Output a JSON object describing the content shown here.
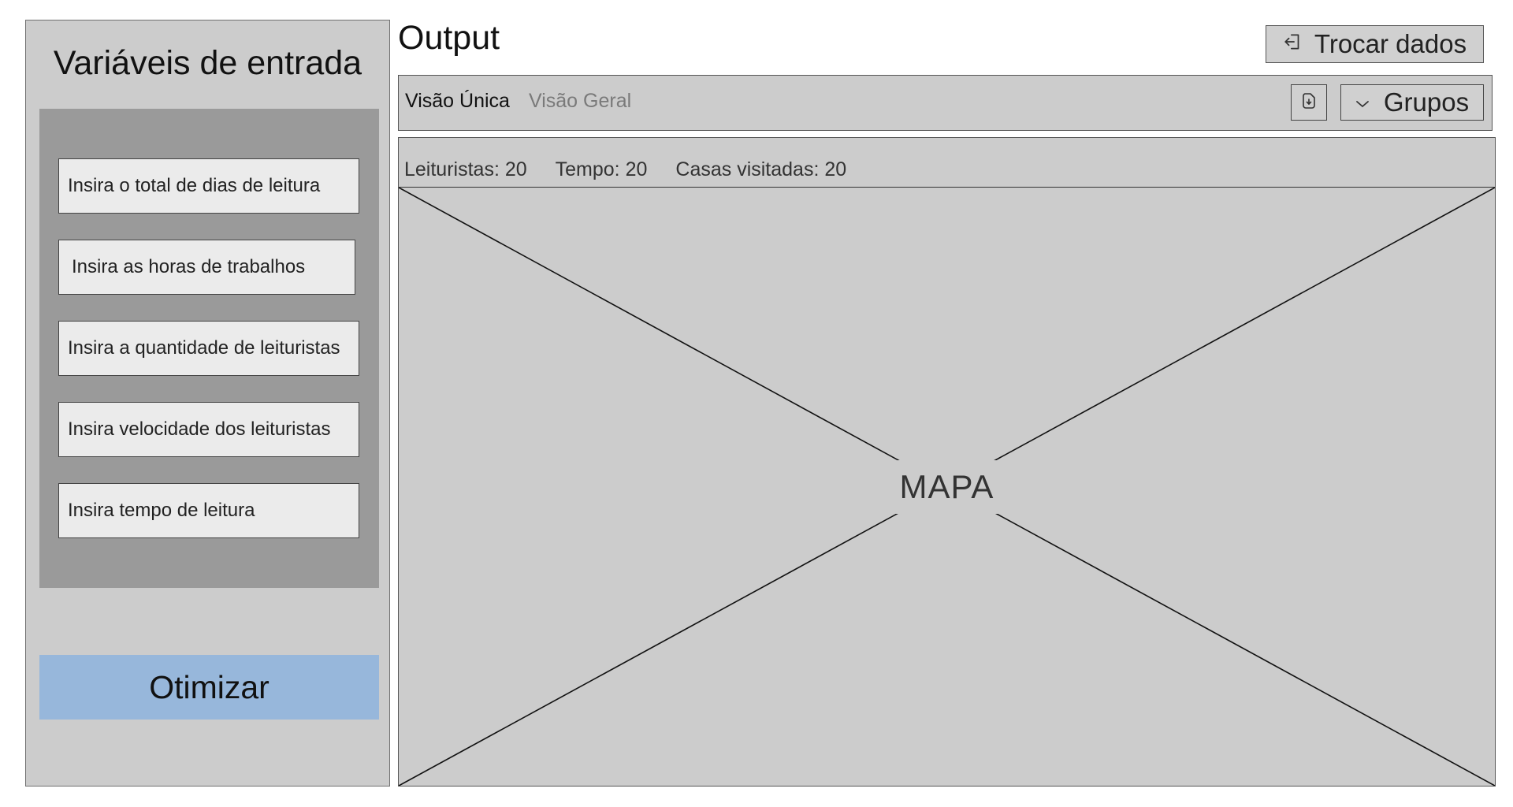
{
  "left_panel": {
    "title": "Variáveis de entrada",
    "fields": [
      {
        "placeholder": "Insira o total de dias de leitura"
      },
      {
        "placeholder": "Insira as horas de trabalhos"
      },
      {
        "placeholder": "Insira a quantidade de leituristas"
      },
      {
        "placeholder": "Insira velocidade dos leituristas"
      },
      {
        "placeholder": "Insira tempo de leitura"
      }
    ],
    "optimize_label": "Otimizar"
  },
  "output": {
    "title": "Output",
    "swap_label": "Trocar dados",
    "swap_icon": "sign-in-icon"
  },
  "tabs": [
    {
      "label": "Visão Única",
      "active": true
    },
    {
      "label": "Visão Geral",
      "active": false
    }
  ],
  "toolbar": {
    "export_icon": "file-download-icon",
    "groups_label": "Grupos",
    "groups_icon": "chevron-down-icon"
  },
  "stats": {
    "readers": "Leituristas: 20",
    "time": "Tempo: 20",
    "houses": "Casas visitadas: 20"
  },
  "map": {
    "placeholder_label": "MAPA"
  },
  "colors": {
    "panel_bg": "#cccccc",
    "input_box_bg": "#9a9a9a",
    "field_bg": "#ebebeb",
    "primary_button": "#97b7db",
    "inactive_tab": "#7a7a7a"
  }
}
